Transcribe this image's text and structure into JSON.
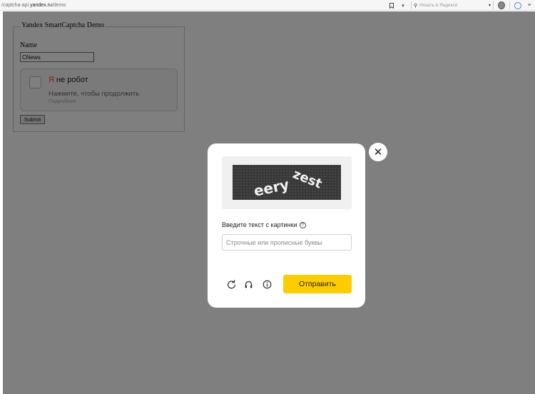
{
  "browser": {
    "url_prefix": "/captcha-api.",
    "url_host": "yandex.ru",
    "url_path": "/demo",
    "search_placeholder": "Искать в Яндексе"
  },
  "form": {
    "legend": "Yandex SmartCaptcha Demo",
    "name_label": "Name",
    "name_value": "CNews",
    "submit_label": "Submit"
  },
  "captcha_checkbox": {
    "brand_letter": "Я",
    "title_rest": " не робот",
    "subtitle": "Нажмите, чтобы продолжить",
    "more_link": "Подробнее"
  },
  "modal": {
    "image_text_1": "eery",
    "image_text_2": "zest",
    "prompt": "Введите текст с картинки",
    "help_glyph": "?",
    "input_placeholder": "Строчные или прописные буквы",
    "input_value": "",
    "submit_label": "Отправить",
    "close_glyph": "✕",
    "controls": [
      "refresh-icon",
      "headphones-icon",
      "info-icon"
    ],
    "accent": "#ffcc00"
  }
}
